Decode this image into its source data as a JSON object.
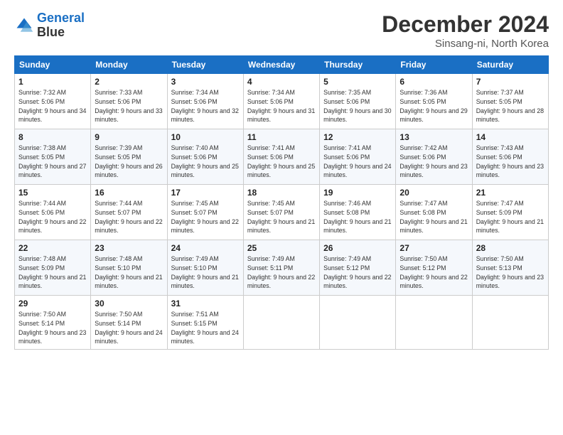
{
  "header": {
    "logo_line1": "General",
    "logo_line2": "Blue",
    "month": "December 2024",
    "location": "Sinsang-ni, North Korea"
  },
  "days_of_week": [
    "Sunday",
    "Monday",
    "Tuesday",
    "Wednesday",
    "Thursday",
    "Friday",
    "Saturday"
  ],
  "weeks": [
    [
      {
        "day": "1",
        "sunrise": "7:32 AM",
        "sunset": "5:06 PM",
        "daylight": "9 hours and 34 minutes."
      },
      {
        "day": "2",
        "sunrise": "7:33 AM",
        "sunset": "5:06 PM",
        "daylight": "9 hours and 33 minutes."
      },
      {
        "day": "3",
        "sunrise": "7:34 AM",
        "sunset": "5:06 PM",
        "daylight": "9 hours and 32 minutes."
      },
      {
        "day": "4",
        "sunrise": "7:34 AM",
        "sunset": "5:06 PM",
        "daylight": "9 hours and 31 minutes."
      },
      {
        "day": "5",
        "sunrise": "7:35 AM",
        "sunset": "5:06 PM",
        "daylight": "9 hours and 30 minutes."
      },
      {
        "day": "6",
        "sunrise": "7:36 AM",
        "sunset": "5:05 PM",
        "daylight": "9 hours and 29 minutes."
      },
      {
        "day": "7",
        "sunrise": "7:37 AM",
        "sunset": "5:05 PM",
        "daylight": "9 hours and 28 minutes."
      }
    ],
    [
      {
        "day": "8",
        "sunrise": "7:38 AM",
        "sunset": "5:05 PM",
        "daylight": "9 hours and 27 minutes."
      },
      {
        "day": "9",
        "sunrise": "7:39 AM",
        "sunset": "5:05 PM",
        "daylight": "9 hours and 26 minutes."
      },
      {
        "day": "10",
        "sunrise": "7:40 AM",
        "sunset": "5:06 PM",
        "daylight": "9 hours and 25 minutes."
      },
      {
        "day": "11",
        "sunrise": "7:41 AM",
        "sunset": "5:06 PM",
        "daylight": "9 hours and 25 minutes."
      },
      {
        "day": "12",
        "sunrise": "7:41 AM",
        "sunset": "5:06 PM",
        "daylight": "9 hours and 24 minutes."
      },
      {
        "day": "13",
        "sunrise": "7:42 AM",
        "sunset": "5:06 PM",
        "daylight": "9 hours and 23 minutes."
      },
      {
        "day": "14",
        "sunrise": "7:43 AM",
        "sunset": "5:06 PM",
        "daylight": "9 hours and 23 minutes."
      }
    ],
    [
      {
        "day": "15",
        "sunrise": "7:44 AM",
        "sunset": "5:06 PM",
        "daylight": "9 hours and 22 minutes."
      },
      {
        "day": "16",
        "sunrise": "7:44 AM",
        "sunset": "5:07 PM",
        "daylight": "9 hours and 22 minutes."
      },
      {
        "day": "17",
        "sunrise": "7:45 AM",
        "sunset": "5:07 PM",
        "daylight": "9 hours and 22 minutes."
      },
      {
        "day": "18",
        "sunrise": "7:45 AM",
        "sunset": "5:07 PM",
        "daylight": "9 hours and 21 minutes."
      },
      {
        "day": "19",
        "sunrise": "7:46 AM",
        "sunset": "5:08 PM",
        "daylight": "9 hours and 21 minutes."
      },
      {
        "day": "20",
        "sunrise": "7:47 AM",
        "sunset": "5:08 PM",
        "daylight": "9 hours and 21 minutes."
      },
      {
        "day": "21",
        "sunrise": "7:47 AM",
        "sunset": "5:09 PM",
        "daylight": "9 hours and 21 minutes."
      }
    ],
    [
      {
        "day": "22",
        "sunrise": "7:48 AM",
        "sunset": "5:09 PM",
        "daylight": "9 hours and 21 minutes."
      },
      {
        "day": "23",
        "sunrise": "7:48 AM",
        "sunset": "5:10 PM",
        "daylight": "9 hours and 21 minutes."
      },
      {
        "day": "24",
        "sunrise": "7:49 AM",
        "sunset": "5:10 PM",
        "daylight": "9 hours and 21 minutes."
      },
      {
        "day": "25",
        "sunrise": "7:49 AM",
        "sunset": "5:11 PM",
        "daylight": "9 hours and 22 minutes."
      },
      {
        "day": "26",
        "sunrise": "7:49 AM",
        "sunset": "5:12 PM",
        "daylight": "9 hours and 22 minutes."
      },
      {
        "day": "27",
        "sunrise": "7:50 AM",
        "sunset": "5:12 PM",
        "daylight": "9 hours and 22 minutes."
      },
      {
        "day": "28",
        "sunrise": "7:50 AM",
        "sunset": "5:13 PM",
        "daylight": "9 hours and 23 minutes."
      }
    ],
    [
      {
        "day": "29",
        "sunrise": "7:50 AM",
        "sunset": "5:14 PM",
        "daylight": "9 hours and 23 minutes."
      },
      {
        "day": "30",
        "sunrise": "7:50 AM",
        "sunset": "5:14 PM",
        "daylight": "9 hours and 24 minutes."
      },
      {
        "day": "31",
        "sunrise": "7:51 AM",
        "sunset": "5:15 PM",
        "daylight": "9 hours and 24 minutes."
      },
      null,
      null,
      null,
      null
    ]
  ]
}
